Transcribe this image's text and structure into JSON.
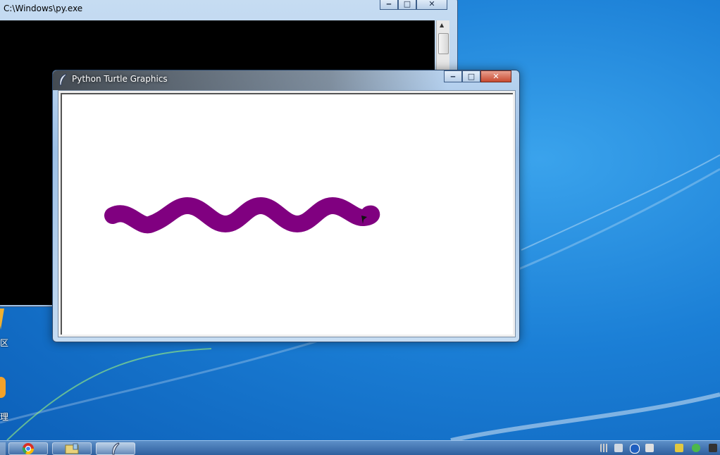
{
  "console_window": {
    "title": "C:\\Windows\\py.exe",
    "buttons": {
      "minimize": "‒",
      "maximize": "□",
      "close": "✕"
    }
  },
  "turtle_window": {
    "title": "Python Turtle Graphics",
    "buttons": {
      "minimize": "‒",
      "maximize": "□",
      "close": "✕"
    },
    "canvas": {
      "stroke_color": "#800080",
      "background": "#ffffff"
    }
  },
  "desktop": {
    "edge_glyphs": [
      "区",
      "理"
    ]
  },
  "taskbar": {
    "buttons": [
      {
        "name": "chrome",
        "icon": "chrome-icon"
      },
      {
        "name": "explorer",
        "icon": "file-explorer-icon"
      },
      {
        "name": "python-turtle",
        "icon": "feather-icon",
        "active": true
      }
    ],
    "tray": [
      "network-icon",
      "help-icon",
      "display-icon",
      "battery-icon",
      "volume-icon",
      "flag-icon"
    ]
  },
  "colors": {
    "desktop_blue": "#1b7fd6",
    "turtle_path": "#800080",
    "close_button": "#c84a30"
  }
}
